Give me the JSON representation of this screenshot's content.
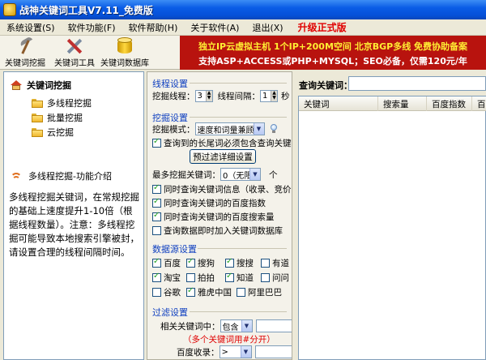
{
  "window": {
    "title": "战神关键词工具V7.11_免费版"
  },
  "menu": {
    "items": [
      "系统设置(S)",
      "软件功能(F)",
      "软件帮助(H)",
      "关于软件(A)",
      "退出(X)"
    ],
    "upgrade": "升级正式版"
  },
  "toolbar": {
    "mine_label": "关键词挖掘",
    "tools_label": "关键词工具",
    "db_label": "关键词数据库"
  },
  "banner": {
    "line1": "独立IP云虚拟主机  1个IP+200M空间  北京BGP多线  免费协助备案",
    "line2": "支持ASP+ACCESS或PHP+MYSQL；SEO必备，仅需120元/年"
  },
  "left": {
    "heading": "关键词挖掘",
    "tree": [
      "多线程挖掘",
      "批量挖掘",
      "云挖掘"
    ],
    "intro_title": "多线程挖掘-功能介绍",
    "intro_text": "多线程挖掘关键词，在常规挖掘的基础上速度提升1-10倍（根据线程数量）。注意：多线程挖掘可能导致本地搜索引擎被封，请设置合理的线程间隔时间。"
  },
  "thread": {
    "title": "线程设置",
    "threads_label": "挖掘线程：",
    "threads_value": "3",
    "interval_label": "线程间隔：",
    "interval_value": "1",
    "interval_unit": "秒"
  },
  "mining": {
    "title": "挖掘设置",
    "mode_label": "挖掘模式：",
    "mode_value": "速度和词量兼顾",
    "must_contain": "查询到的长尾词必须包含查询关键词",
    "filter_button": "预过滤详细设置",
    "max_label": "最多挖掘关键词：",
    "max_value": "0（无限",
    "max_unit": "个",
    "opt1": "同时查询关键词信息（收录、竞价等）",
    "opt2": "同时查询关键词的百度指数",
    "opt3": "同时查询关键词的百度搜索量",
    "opt4": "查询数据即时加入关键词数据库"
  },
  "sources": {
    "title": "数据源设置",
    "items": [
      {
        "label": "百度",
        "checked": true
      },
      {
        "label": "搜狗",
        "checked": true
      },
      {
        "label": "搜搜",
        "checked": true
      },
      {
        "label": "有道",
        "checked": false
      },
      {
        "label": "淘宝",
        "checked": true
      },
      {
        "label": "拍拍",
        "checked": false
      },
      {
        "label": "知道",
        "checked": true
      },
      {
        "label": "问问",
        "checked": false
      },
      {
        "label": "谷歌",
        "checked": false
      },
      {
        "label": "雅虎中国",
        "checked": true
      },
      {
        "label": "阿里巴巴",
        "checked": false
      }
    ]
  },
  "filter": {
    "title": "过滤设置",
    "related_label": "相关关键词中：",
    "related_value": "包含",
    "hint": "（多个关键词用#分开）",
    "index_label": "百度收录：",
    "index_value": ">"
  },
  "right": {
    "query_label": "查询关键词：",
    "columns": [
      "关键词",
      "搜索量",
      "百度指数",
      "百"
    ]
  }
}
